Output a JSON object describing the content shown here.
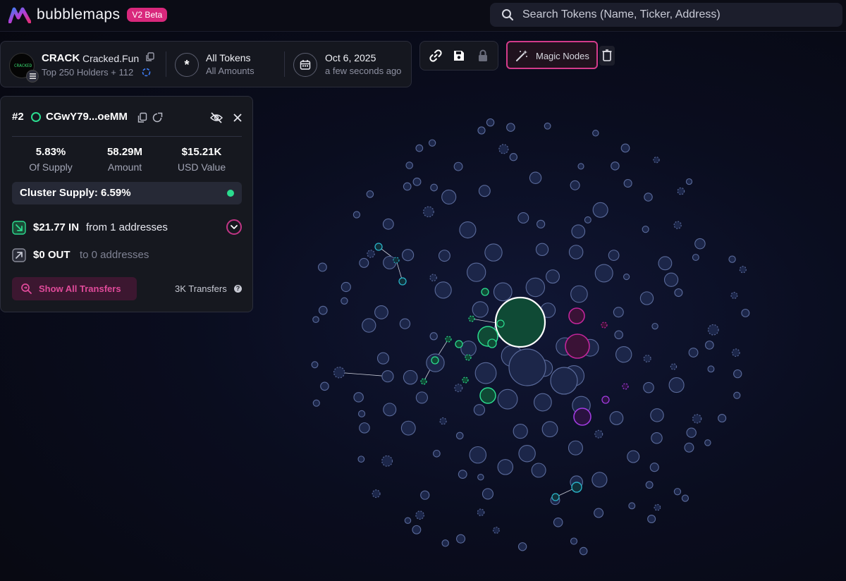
{
  "header": {
    "brand": "bubblemaps",
    "badge": "V2 Beta",
    "search_placeholder": "Search Tokens (Name, Ticker, Address)"
  },
  "token": {
    "symbol": "CRACK",
    "name": "Cracked.Fun",
    "holders": "Top 250 Holders + 112",
    "filter_title": "All Tokens",
    "filter_sub": "All Amounts",
    "date": "Oct 6, 2025",
    "date_relative": "a few seconds ago"
  },
  "toolbar": {
    "magic_nodes_label": "Magic Nodes"
  },
  "detail": {
    "rank": "#2",
    "address": "CGwY79...oeMM",
    "stats": [
      {
        "value": "5.83%",
        "label": "Of Supply"
      },
      {
        "value": "58.29M",
        "label": "Amount"
      },
      {
        "value": "$15.21K",
        "label": "USD Value"
      }
    ],
    "cluster_supply": "Cluster Supply: 6.59%",
    "in_amount": "$21.77 IN",
    "in_text": "from 1 addresses",
    "out_amount": "$0 OUT",
    "out_text": "to 0 addresses",
    "show_all_label": "Show All Transfers",
    "transfers_count": "3K Transfers"
  },
  "colors": {
    "accent_pink": "#d9287c",
    "green": "#2bdc8f",
    "magenta": "#c2259a",
    "purple": "#a13be0",
    "cyan": "#2ab3c8",
    "node": "#1c2649"
  }
}
